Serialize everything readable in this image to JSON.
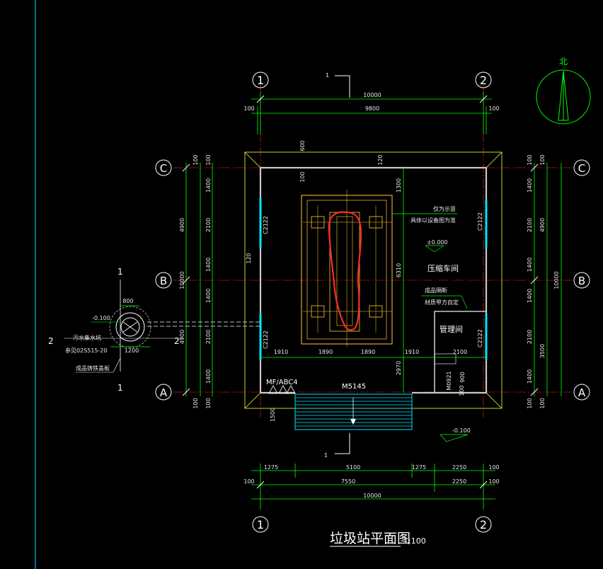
{
  "drawing": {
    "title": "垃圾站平面图",
    "scale": "1:100",
    "north_label": "北",
    "grid_axes": {
      "vertical": [
        "1",
        "2"
      ],
      "horizontal": [
        "C",
        "B",
        "A"
      ]
    },
    "section_mark": "1",
    "top_dims": {
      "overall": "10000",
      "inner": "9800",
      "left_off": "100",
      "right_off": "100"
    },
    "bottom_dims": {
      "row1": [
        "1275",
        "5100",
        "1275",
        "2250",
        "100"
      ],
      "row2": [
        "100",
        "7550",
        "2250",
        "100"
      ],
      "overall": "10000"
    },
    "left_dims": {
      "outer": [
        "4900",
        "10000",
        "4900"
      ],
      "inner": [
        "100",
        "1400",
        "2100",
        "1400",
        "1400",
        "2100",
        "1400",
        "100"
      ]
    },
    "right_dims": {
      "outer": [
        "4900",
        "10000",
        "3500"
      ],
      "inner": [
        "100",
        "1400",
        "2100",
        "1400",
        "1400",
        "2100",
        "1400",
        "100"
      ]
    },
    "window_left_upper": "C2122",
    "window_left_lower": "C2122",
    "window_right_upper": "C2122",
    "window_right_lower": "C2122",
    "room_main": "压缩车间",
    "room_office": "管理间",
    "note_equipment_1": "仅为示意",
    "note_equipment_2": "具体以设备图为准",
    "note_partition_1": "成品隔断",
    "note_partition_2": "材质甲方自定",
    "elev_inside": "±0.000",
    "elev_outside": "-0.100",
    "elev_pit": "-0.100",
    "door_main": "M5145",
    "door_office": "M0921",
    "extinguisher": "MF/ABC4",
    "pit_label": "污水集水坑",
    "pit_ref": "参见02S515-20",
    "pit_cover": "成品铸铁盖板",
    "pit_dim_top": "800",
    "pit_dim_bottom": "1200",
    "pit_section_left": "2",
    "pit_section_right": "2",
    "interior_dims": [
      "1910",
      "1890",
      "1890",
      "1910",
      "2100"
    ],
    "misc_dims": {
      "d600": "600",
      "d100a": "100",
      "d100b": "100",
      "d1300": "1300",
      "d6310": "6310",
      "d2970": "2970",
      "d900": "900",
      "d1500": "1500",
      "d120a": "120",
      "d120b": "120"
    },
    "colors": {
      "background": "#000000",
      "dimension": "#00ff00",
      "axis": "#ff2020",
      "wall": "#ffff33",
      "window": "#00e5ff",
      "annotation": "#ff2a2a"
    }
  }
}
